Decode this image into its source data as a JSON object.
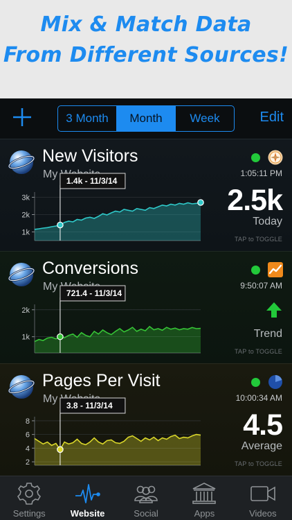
{
  "banner": {
    "line1": "Mix & Match Data",
    "line2": "From Different Sources!"
  },
  "toolbar": {
    "add_icon": "plus-icon",
    "segments": [
      {
        "label": "3 Month",
        "active": false
      },
      {
        "label": "Month",
        "active": true
      },
      {
        "label": "Week",
        "active": false
      }
    ],
    "edit_label": "Edit"
  },
  "colors": {
    "accent": "#1d8bf0",
    "status_green": "#22c93a",
    "series_teal": "#2fc9c9",
    "series_green": "#36c436",
    "series_yellow": "#d9d62a"
  },
  "cards": [
    {
      "title": "New Visitors",
      "subtitle": "My Website",
      "status_icon": "status-dot-icon",
      "source_icon": "compass-icon",
      "time": "1:05:11 PM",
      "value": "2.5k",
      "label": "Today",
      "tap_hint": "TAP to TOGGLE",
      "tooltip": {
        "value": "1.4k",
        "date": " - 11/3/14"
      },
      "chart_data": {
        "type": "area",
        "yticks": [
          "3k",
          "2k",
          "1k"
        ],
        "ylim": [
          500,
          3300
        ],
        "selected_index": 6,
        "values": [
          1150,
          1180,
          1220,
          1250,
          1300,
          1340,
          1400,
          1550,
          1620,
          1580,
          1720,
          1680,
          1800,
          1850,
          1780,
          1900,
          2050,
          1980,
          2100,
          2200,
          2150,
          2300,
          2250,
          2200,
          2350,
          2300,
          2250,
          2400,
          2350,
          2450,
          2550,
          2500,
          2600,
          2550,
          2650,
          2600,
          2680,
          2620,
          2650,
          2700
        ]
      }
    },
    {
      "title": "Conversions",
      "subtitle": "My Website",
      "status_icon": "status-dot-icon",
      "source_icon": "analytics-icon",
      "time": "9:50:07 AM",
      "value": "",
      "label": "Trend",
      "trend_icon": "up-arrow-icon",
      "tap_hint": "TAP to TOGGLE",
      "tooltip": {
        "value": "721.4",
        "date": " - 11/3/14"
      },
      "chart_data": {
        "type": "area",
        "yticks": [
          "2k",
          "1k"
        ],
        "ylim": [
          400,
          2200
        ],
        "selected_index": 6,
        "values": [
          820,
          900,
          860,
          950,
          980,
          920,
          1000,
          960,
          1050,
          1100,
          980,
          1150,
          1050,
          1000,
          1200,
          1100,
          1250,
          1150,
          1080,
          1200,
          1300,
          1180,
          1250,
          1350,
          1200,
          1280,
          1220,
          1380,
          1260,
          1300,
          1240,
          1350,
          1280,
          1320,
          1260,
          1300,
          1280,
          1340,
          1300,
          1310
        ]
      }
    },
    {
      "title": "Pages Per Visit",
      "subtitle": "My Website",
      "status_icon": "status-dot-icon",
      "source_icon": "pie-chart-icon",
      "time": "10:00:34 AM",
      "value": "4.5",
      "label": "Average",
      "tap_hint": "TAP to TOGGLE",
      "tooltip": {
        "value": "3.8",
        "date": " - 11/3/14"
      },
      "chart_data": {
        "type": "area",
        "yticks": [
          "8",
          "6",
          "4",
          "2"
        ],
        "ylim": [
          1.5,
          8.6
        ],
        "selected_index": 6,
        "values": [
          5.4,
          5.0,
          4.6,
          4.9,
          4.4,
          4.7,
          3.8,
          4.9,
          4.6,
          4.8,
          5.3,
          4.7,
          4.5,
          4.9,
          5.5,
          4.9,
          4.6,
          5.1,
          5.2,
          4.8,
          4.7,
          5.0,
          5.6,
          5.8,
          5.4,
          5.0,
          5.5,
          5.2,
          5.6,
          5.1,
          5.5,
          5.3,
          5.7,
          5.9,
          5.4,
          5.6,
          5.5,
          5.8,
          6.0,
          5.9
        ]
      }
    }
  ],
  "tabbar": {
    "tabs": [
      {
        "label": "Settings",
        "icon": "gear-icon",
        "active": false
      },
      {
        "label": "Website",
        "icon": "pulse-icon",
        "active": true
      },
      {
        "label": "Social",
        "icon": "people-icon",
        "active": false
      },
      {
        "label": "Apps",
        "icon": "bank-icon",
        "active": false
      },
      {
        "label": "Videos",
        "icon": "video-camera-icon",
        "active": false
      }
    ]
  }
}
